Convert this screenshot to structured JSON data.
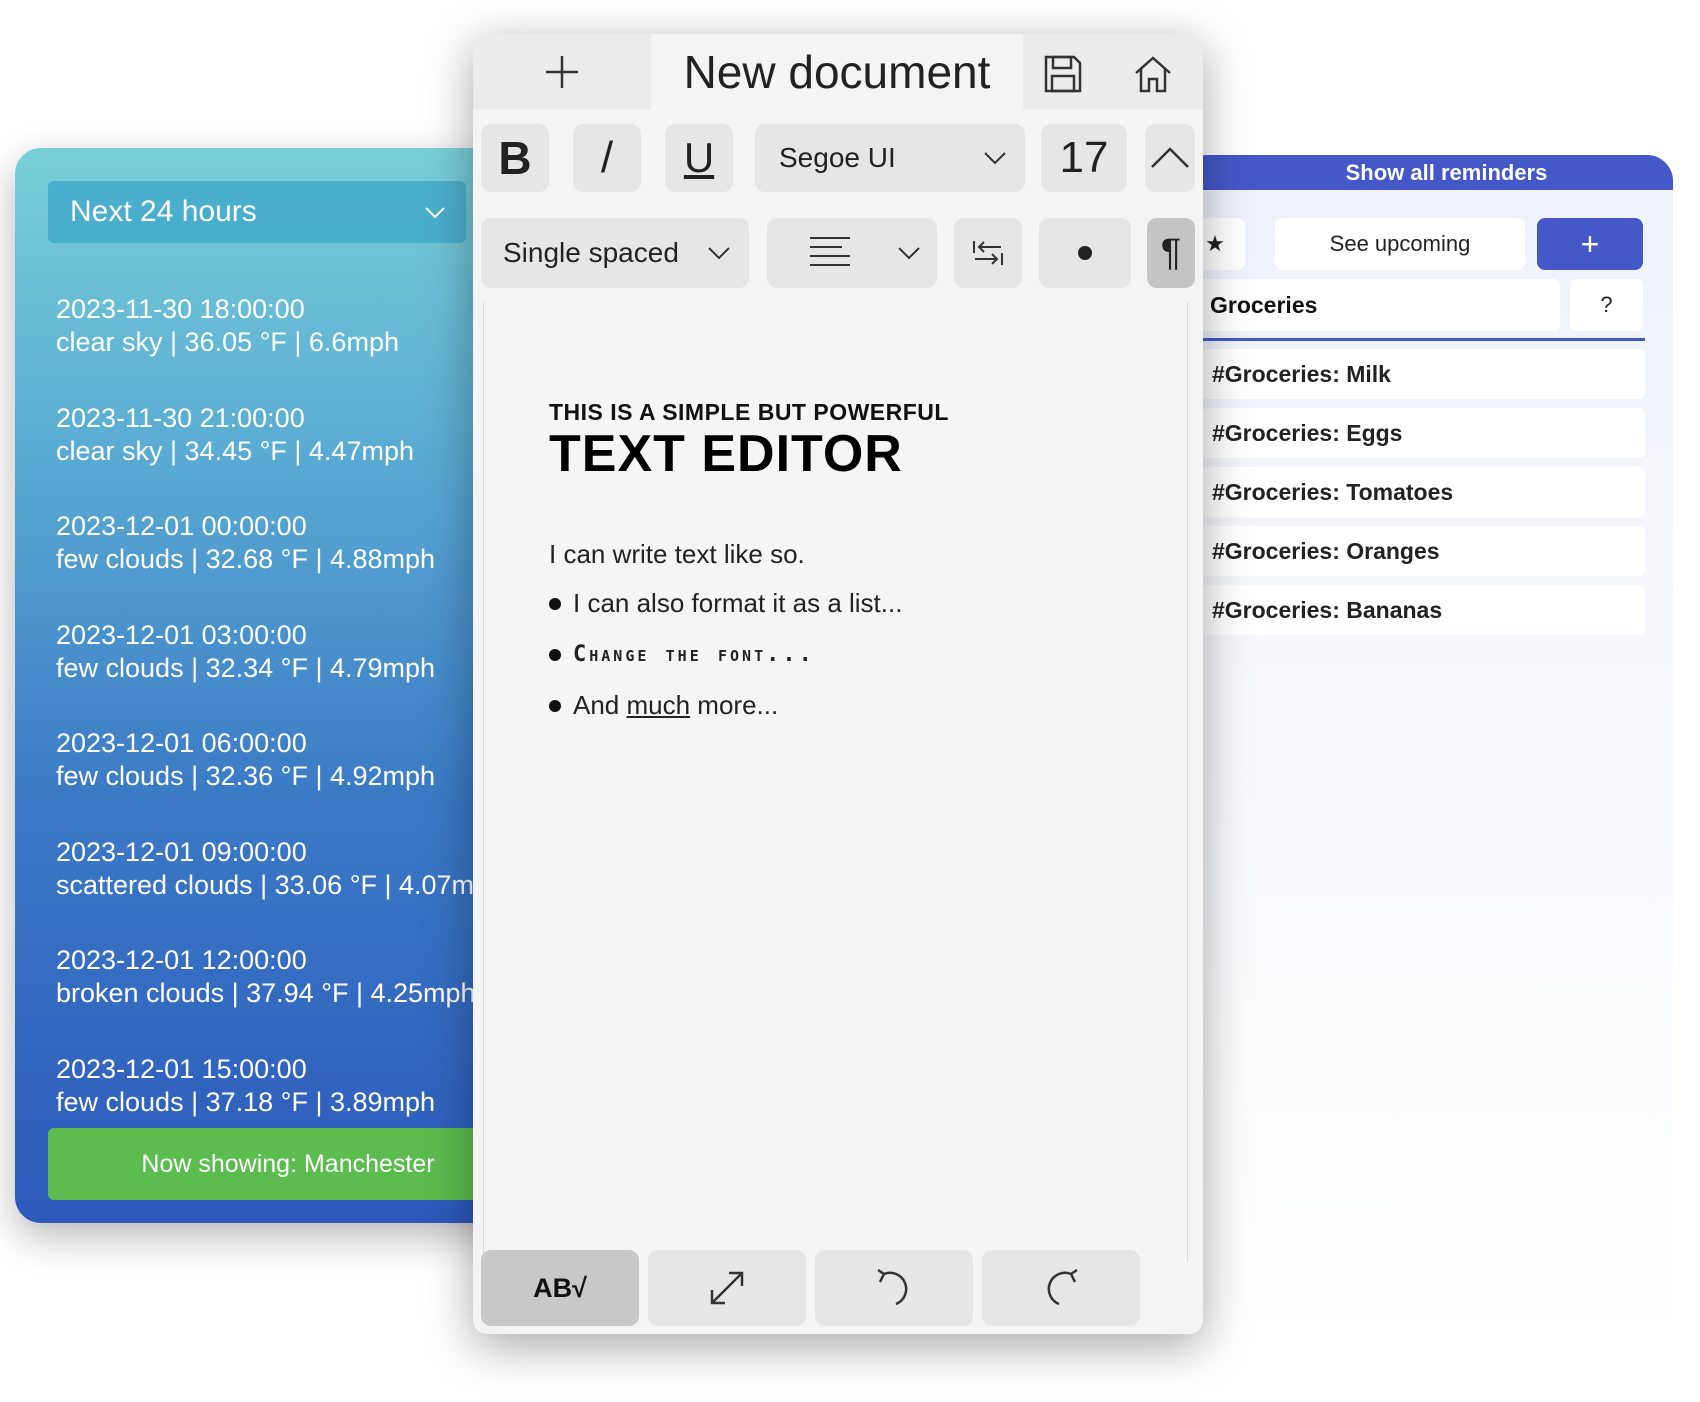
{
  "weather": {
    "range_select": "Next 24 hours",
    "forecasts": [
      {
        "time": "2023-11-30 18:00:00",
        "summary": "clear sky | 36.05 °F | 6.6mph"
      },
      {
        "time": "2023-11-30 21:00:00",
        "summary": "clear sky | 34.45 °F | 4.47mph"
      },
      {
        "time": "2023-12-01 00:00:00",
        "summary": "few clouds | 32.68 °F | 4.88mph"
      },
      {
        "time": "2023-12-01 03:00:00",
        "summary": "few clouds | 32.34 °F | 4.79mph"
      },
      {
        "time": "2023-12-01 06:00:00",
        "summary": "few clouds | 32.36 °F | 4.92mph"
      },
      {
        "time": "2023-12-01 09:00:00",
        "summary": "scattered clouds | 33.06 °F | 4.07m"
      },
      {
        "time": "2023-12-01 12:00:00",
        "summary": "broken clouds | 37.94 °F | 4.25mph"
      },
      {
        "time": "2023-12-01 15:00:00",
        "summary": "few clouds | 37.18 °F | 3.89mph"
      }
    ],
    "now_showing": "Now showing: Manchester"
  },
  "editor": {
    "title": "New document",
    "bold_label": "B",
    "italic_label": "/",
    "underline_label": "U",
    "font": "Segoe UI",
    "font_size": "17",
    "spacing": "Single spaced",
    "pilcrow": "¶",
    "spellcheck_label": "AB√",
    "doc": {
      "heading_small": "THIS IS A SIMPLE BUT POWERFUL",
      "heading_big": "TEXT EDITOR",
      "paragraph": "I can write text like so.",
      "bullet1": "I can also format it as a list...",
      "bullet2": "Change the font...",
      "bullet3_pre": "And ",
      "bullet3_underlined": "much",
      "bullet3_post": " more..."
    }
  },
  "reminders": {
    "header": "Show all reminders",
    "star": "★",
    "see_upcoming": "See upcoming",
    "add": "+",
    "group": "Groceries",
    "help": "?",
    "items": [
      "#Groceries: Milk",
      "#Groceries: Eggs",
      "#Groceries: Tomatoes",
      "#Groceries: Oranges",
      "#Groceries: Bananas"
    ]
  },
  "colors": {
    "reminder_accent": "#4458c8",
    "weather_button": "#5cbc4f"
  }
}
